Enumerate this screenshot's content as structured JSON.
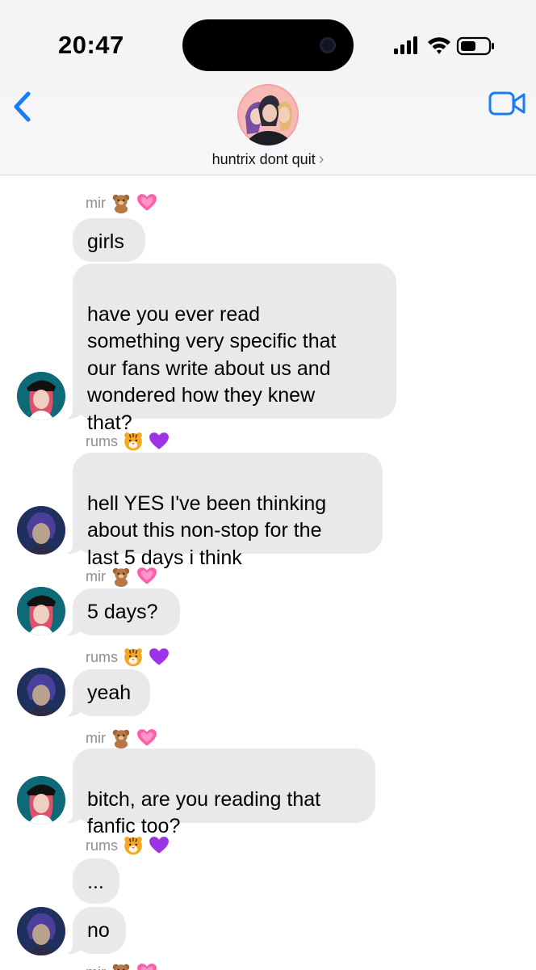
{
  "status_bar": {
    "time": "20:47",
    "icons": [
      "signal-icon",
      "wifi-icon",
      "battery-icon"
    ]
  },
  "header": {
    "group_name": "huntrix dont quit",
    "chevron": "›",
    "icons": [
      "back-chevron-icon",
      "video-call-icon",
      "group-avatar"
    ],
    "accent_color": "#1a7cf5"
  },
  "senders": {
    "mir": {
      "name": "mir",
      "emojis": [
        "teddy-bear",
        "pink-heart"
      ]
    },
    "rums": {
      "name": "rums",
      "emojis": [
        "tiger-face",
        "purple-heart"
      ]
    }
  },
  "messages": [
    {
      "sender": "mir",
      "show_name": true,
      "text": "girls"
    },
    {
      "sender": "mir",
      "text": "have you ever read\nsomething very specific that\nour fans write about us and\nwondered how they knew\nthat?"
    },
    {
      "sender": "rums",
      "show_name": true,
      "text": "hell YES I've been thinking\nabout this non-stop for the\nlast 5 days i think"
    },
    {
      "sender": "mir",
      "show_name": true,
      "text": "5 days?"
    },
    {
      "sender": "rums",
      "show_name": true,
      "text": "yeah"
    },
    {
      "sender": "mir",
      "show_name": true,
      "text": "bitch, are you reading that\nfanfic too?"
    },
    {
      "sender": "rums",
      "show_name": true,
      "text": "..."
    },
    {
      "sender": "rums",
      "text": "no"
    }
  ],
  "colors": {
    "incoming_bubble": "#e9e9eb",
    "sender_name": "#8e8e93",
    "header_bg": "#f5f5f7"
  }
}
